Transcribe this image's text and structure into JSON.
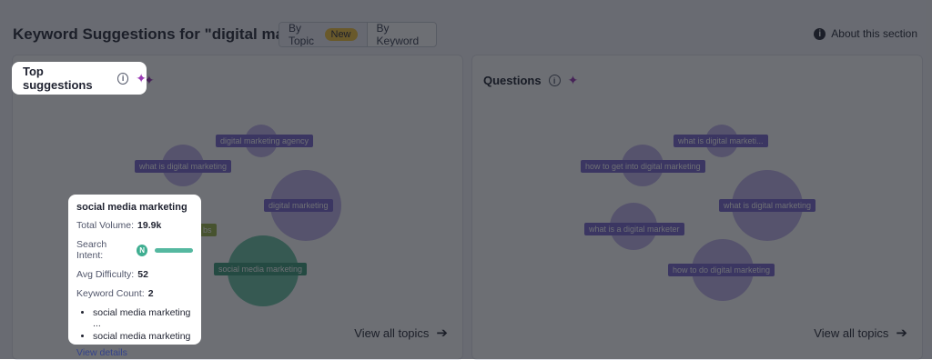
{
  "header": {
    "title": "Keyword Suggestions for \"digital marketing\"",
    "toggle": {
      "by_topic": "By Topic",
      "new_badge": "New",
      "by_keyword": "By Keyword",
      "active": "by_topic"
    },
    "about": "About this section"
  },
  "left_panel": {
    "title": "Top suggestions",
    "view_all": "View all topics",
    "nodes": [
      {
        "label": "digital marketing agency"
      },
      {
        "label": "what is digital marketing"
      },
      {
        "label": "digital marketing"
      },
      {
        "label": "bs"
      },
      {
        "label": "social media marketing"
      }
    ]
  },
  "right_panel": {
    "title": "Questions",
    "view_all": "View all topics",
    "nodes": [
      {
        "label": "what is digital marketi..."
      },
      {
        "label": "how to get into digital marketing"
      },
      {
        "label": "what is digital marketing"
      },
      {
        "label": "what is a digital marketer"
      },
      {
        "label": "how to do digital marketing"
      }
    ]
  },
  "tooltip": {
    "title": "social media marketing",
    "total_volume_label": "Total Volume:",
    "total_volume": "19.9k",
    "search_intent_label": "Search Intent:",
    "search_intent_badge": "N",
    "avg_difficulty_label": "Avg Difficulty:",
    "avg_difficulty": "52",
    "keyword_count_label": "Keyword Count:",
    "keyword_count": "2",
    "keywords": [
      "social media marketing ...",
      "social media marketing"
    ],
    "view_details": "View details"
  },
  "colors": {
    "accent_purple": "#7c69d0",
    "circle_purple": "#c3b5ec",
    "green": "#3f9f7c",
    "new_badge": "#f5c541",
    "spark": "#9b3bb5"
  }
}
